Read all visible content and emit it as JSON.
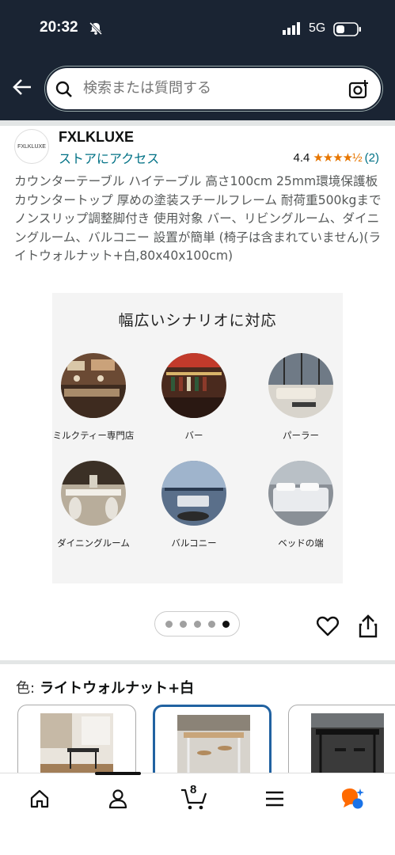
{
  "status_bar": {
    "time": "20:32",
    "network": "5G"
  },
  "search": {
    "placeholder": "検索または質問する"
  },
  "store": {
    "logo_text": "FXLKLUXE",
    "name": "FXLKLUXE",
    "link": "ストアにアクセス",
    "rating": "4.4",
    "stars": "★★★★½",
    "rating_count": "(2)"
  },
  "product": {
    "title": "カウンターテーブル ハイテーブル 高さ100cm 25mm環境保護板カウンタートップ 厚めの塗装スチールフレーム 耐荷重500kgまで ノンスリップ調整脚付き 使用対象 バー、リビングルーム、ダイニングルーム、バルコニー 設置が簡単 (椅子は含まれていません)(ライトウォルナット+白,80x40x100cm)"
  },
  "image_panel": {
    "heading": "幅広いシナリオに対応",
    "scenes": [
      {
        "label": "ミルクティー専門店"
      },
      {
        "label": "バー"
      },
      {
        "label": "パーラー"
      },
      {
        "label": "ダイニングルーム"
      },
      {
        "label": "バルコニー"
      },
      {
        "label": "ベッドの端"
      }
    ]
  },
  "carousel": {
    "total": 5,
    "active_index": 4
  },
  "color": {
    "key": "色:",
    "value": "ライトウォルナット+白"
  },
  "cart": {
    "count": "8"
  },
  "colors": {
    "header_bg": "#1a2433",
    "link": "#007185",
    "star": "#e77600",
    "selected_border": "#2162a1",
    "alexa_orange": "#ff6a00",
    "alexa_blue": "#1a73e8"
  }
}
